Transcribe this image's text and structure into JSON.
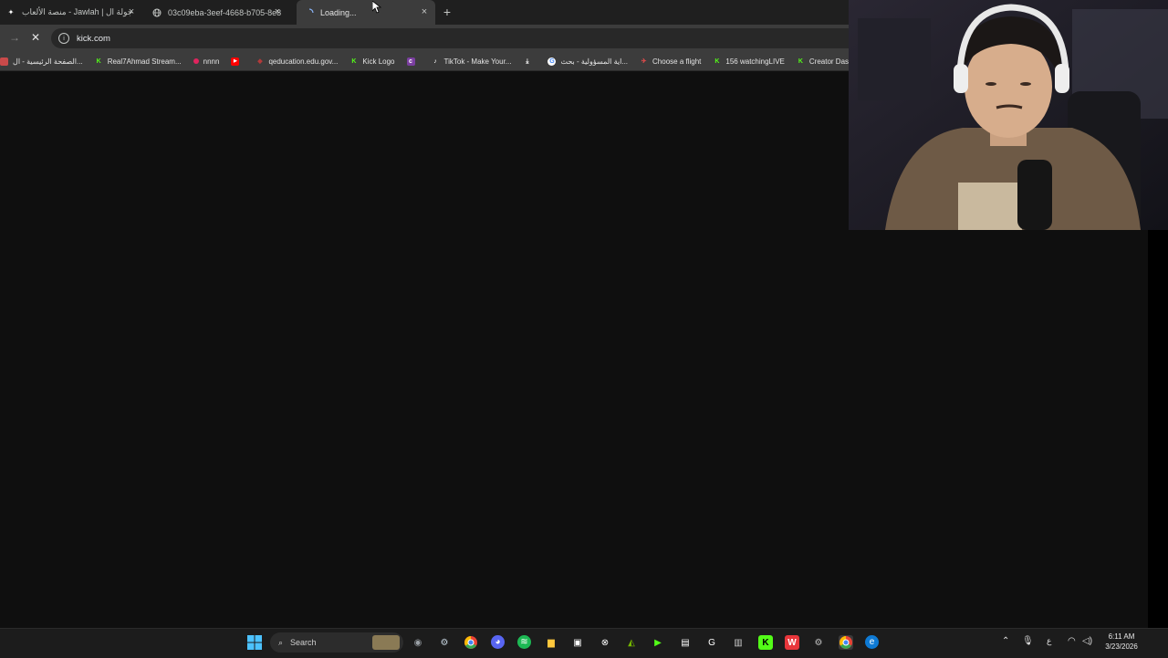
{
  "tabs": [
    {
      "title": "منصة الألعاب - Jawlah | جولة ال",
      "favicon": "jawlah-icon"
    },
    {
      "title": "03c09eba-3eef-4668-b705-8e8",
      "favicon": "globe-icon"
    },
    {
      "title": "Loading...",
      "favicon": "loading-spinner-icon",
      "active": true
    }
  ],
  "new_tab_label": "+",
  "address_bar": {
    "url": "kick.com"
  },
  "bookmarks": [
    {
      "label": "الصفحة الرئيسية - ال...",
      "icon": "arabic-site-icon",
      "color": "#c94a4a"
    },
    {
      "label": "Real7Ahmad Stream...",
      "icon": "kick-icon",
      "color": "#53fc18"
    },
    {
      "label": "nnnn",
      "icon": "red-dot-icon",
      "color": "#e0245e"
    },
    {
      "label": "",
      "icon": "youtube-icon",
      "color": "#ff0000"
    },
    {
      "label": "qeducation.edu.gov...",
      "icon": "education-icon",
      "color": "#b23a3a"
    },
    {
      "label": "Kick Logo",
      "icon": "kick-icon",
      "color": "#53fc18"
    },
    {
      "label": "",
      "icon": "c-icon",
      "color": "#7b3fa0"
    },
    {
      "label": "TikTok - Make Your...",
      "icon": "tiktok-icon",
      "color": "#ffffff"
    },
    {
      "label": "",
      "icon": "download-icon",
      "color": "#ffffff"
    },
    {
      "label": "اية المسؤولية - بحث...",
      "icon": "google-icon",
      "color": "#4285f4"
    },
    {
      "label": "Choose a flight",
      "icon": "flight-icon",
      "color": "#e04b4b"
    },
    {
      "label": "156 watchingLIVE",
      "icon": "kick-icon",
      "color": "#53fc18"
    },
    {
      "label": "Creator Dashb",
      "icon": "kick-icon",
      "color": "#53fc18"
    }
  ],
  "taskbar": {
    "search_label": "Search",
    "apps": [
      "start-icon",
      "search-icon",
      "camera-icon",
      "steam-icon",
      "chrome-icon",
      "discord-icon",
      "spotify-icon",
      "file-explorer-icon",
      "store-icon",
      "xbox-icon",
      "nvidia-icon",
      "play-icon",
      "notepad-icon",
      "g-icon",
      "trash-icon",
      "kick-icon",
      "wps-icon",
      "settings-icon",
      "chrome-active-icon",
      "edge-icon"
    ]
  },
  "tray": {
    "lang": "ع",
    "time": "6:11 AM",
    "date": "3/23/2026"
  }
}
